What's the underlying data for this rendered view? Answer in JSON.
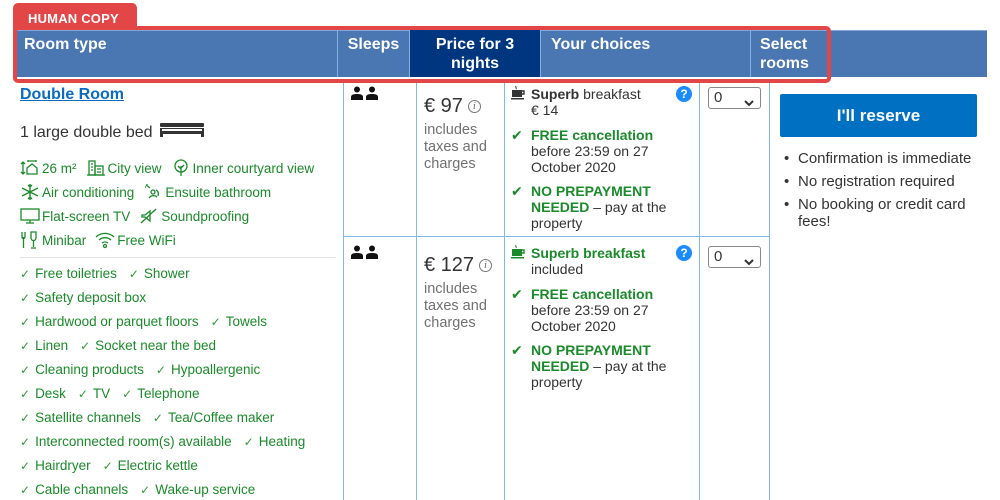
{
  "badge": {
    "label": "HUMAN COPY"
  },
  "colors": {
    "header_bg": "#4a76b1",
    "header_active_bg": "#003580",
    "frame": "#e24646",
    "green": "#1a8a2a",
    "link": "#0a6bbf",
    "button": "#0071c2"
  },
  "table": {
    "headers": [
      "Room type",
      "Sleeps",
      "Price for 3 nights",
      "Your choices",
      "Select rooms"
    ]
  },
  "room": {
    "name": "Double Room",
    "bed": "1 large double bed",
    "facilities": [
      [
        {
          "icon": "room-size-icon",
          "label": "26 m²"
        },
        {
          "icon": "city-view-icon",
          "label": "City view"
        },
        {
          "icon": "tree-icon",
          "label": "Inner courtyard view"
        }
      ],
      [
        {
          "icon": "snowflake-icon",
          "label": "Air conditioning"
        },
        {
          "icon": "bath-icon",
          "label": "Ensuite bathroom"
        }
      ],
      [
        {
          "icon": "tv-icon",
          "label": "Flat-screen TV"
        },
        {
          "icon": "soundproof-icon",
          "label": "Soundproofing"
        }
      ],
      [
        {
          "icon": "minibar-icon",
          "label": "Minibar"
        },
        {
          "icon": "wifi-icon",
          "label": "Free WiFi"
        }
      ]
    ],
    "amenities": [
      [
        "Free toiletries",
        "Shower"
      ],
      [
        "Safety deposit box"
      ],
      [
        "Hardwood or parquet floors",
        "Towels"
      ],
      [
        "Linen",
        "Socket near the bed"
      ],
      [
        "Cleaning products",
        "Hypoallergenic"
      ],
      [
        "Desk",
        "TV",
        "Telephone"
      ],
      [
        "Satellite channels",
        "Tea/Coffee maker"
      ],
      [
        "Interconnected room(s) available",
        "Heating"
      ],
      [
        "Hairdryer",
        "Electric kettle"
      ],
      [
        "Cable channels",
        "Wake-up service"
      ]
    ]
  },
  "options": [
    {
      "price": "€ 97",
      "price_note": "includes taxes and charges",
      "breakfast_bold": "Superb",
      "breakfast_rest": "breakfast",
      "breakfast_line2": "€ 14",
      "cancel_title": "FREE cancellation",
      "cancel_detail": "before 23:59 on 27 October 2020",
      "prepay_title": "NO PREPAYMENT NEEDED",
      "prepay_detail": "– pay at the property",
      "select_value": "0"
    },
    {
      "price": "€ 127",
      "price_note": "includes taxes and charges",
      "breakfast_bold": "Superb breakfast",
      "breakfast_rest": "",
      "breakfast_line2": "included",
      "cancel_title": "FREE cancellation",
      "cancel_detail": "before 23:59 on 27 October 2020",
      "prepay_title": "NO PREPAYMENT NEEDED",
      "prepay_detail": "– pay at the property",
      "select_value": "0"
    }
  ],
  "reserve": {
    "button_label": "I'll reserve",
    "bullets": [
      "Confirmation is immediate",
      "No registration required",
      "No booking or credit card fees!"
    ]
  }
}
